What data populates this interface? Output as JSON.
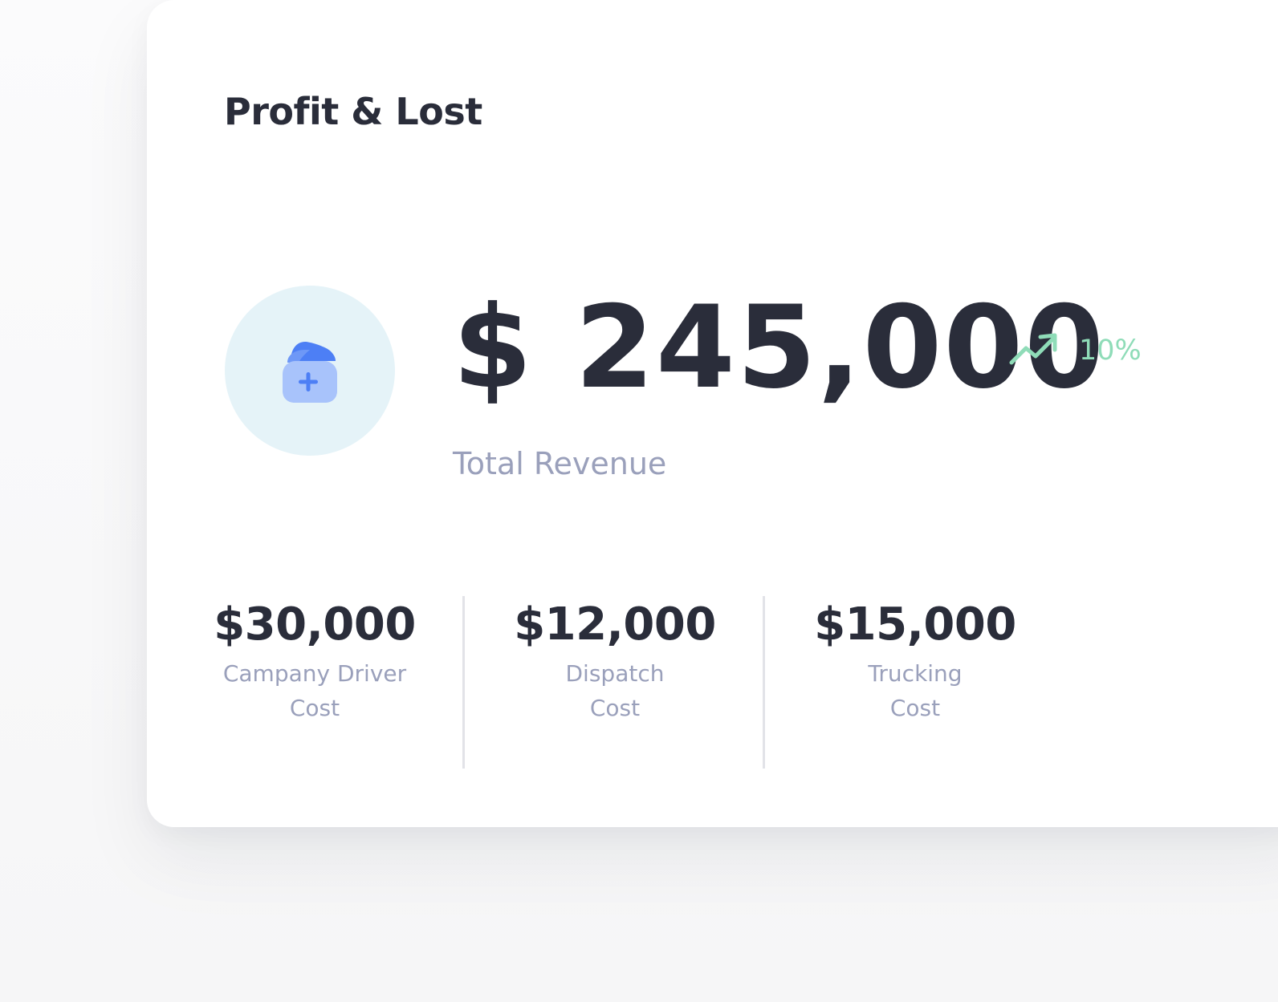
{
  "card": {
    "title": "Profit & Lost"
  },
  "revenue": {
    "amount": "$ 245,000",
    "label": "Total Revenue",
    "trend_percent": "10%",
    "icon": "wallet-add-icon",
    "trend_icon": "trending-up-icon"
  },
  "stats": [
    {
      "value": "$30,000",
      "label_line1": "Campany Driver",
      "label_line2": "Cost"
    },
    {
      "value": "$12,000",
      "label_line1": "Dispatch",
      "label_line2": "Cost"
    },
    {
      "value": "$15,000",
      "label_line1": "Trucking",
      "label_line2": "Cost"
    }
  ],
  "colors": {
    "text_primary": "#2a2d3a",
    "text_muted": "#9aa0bb",
    "trend_green": "#8fdcb8",
    "icon_circle_bg": "#e5f3f8",
    "icon_blue": "#4d7ff5",
    "icon_blue_light": "#a8c3fb"
  }
}
